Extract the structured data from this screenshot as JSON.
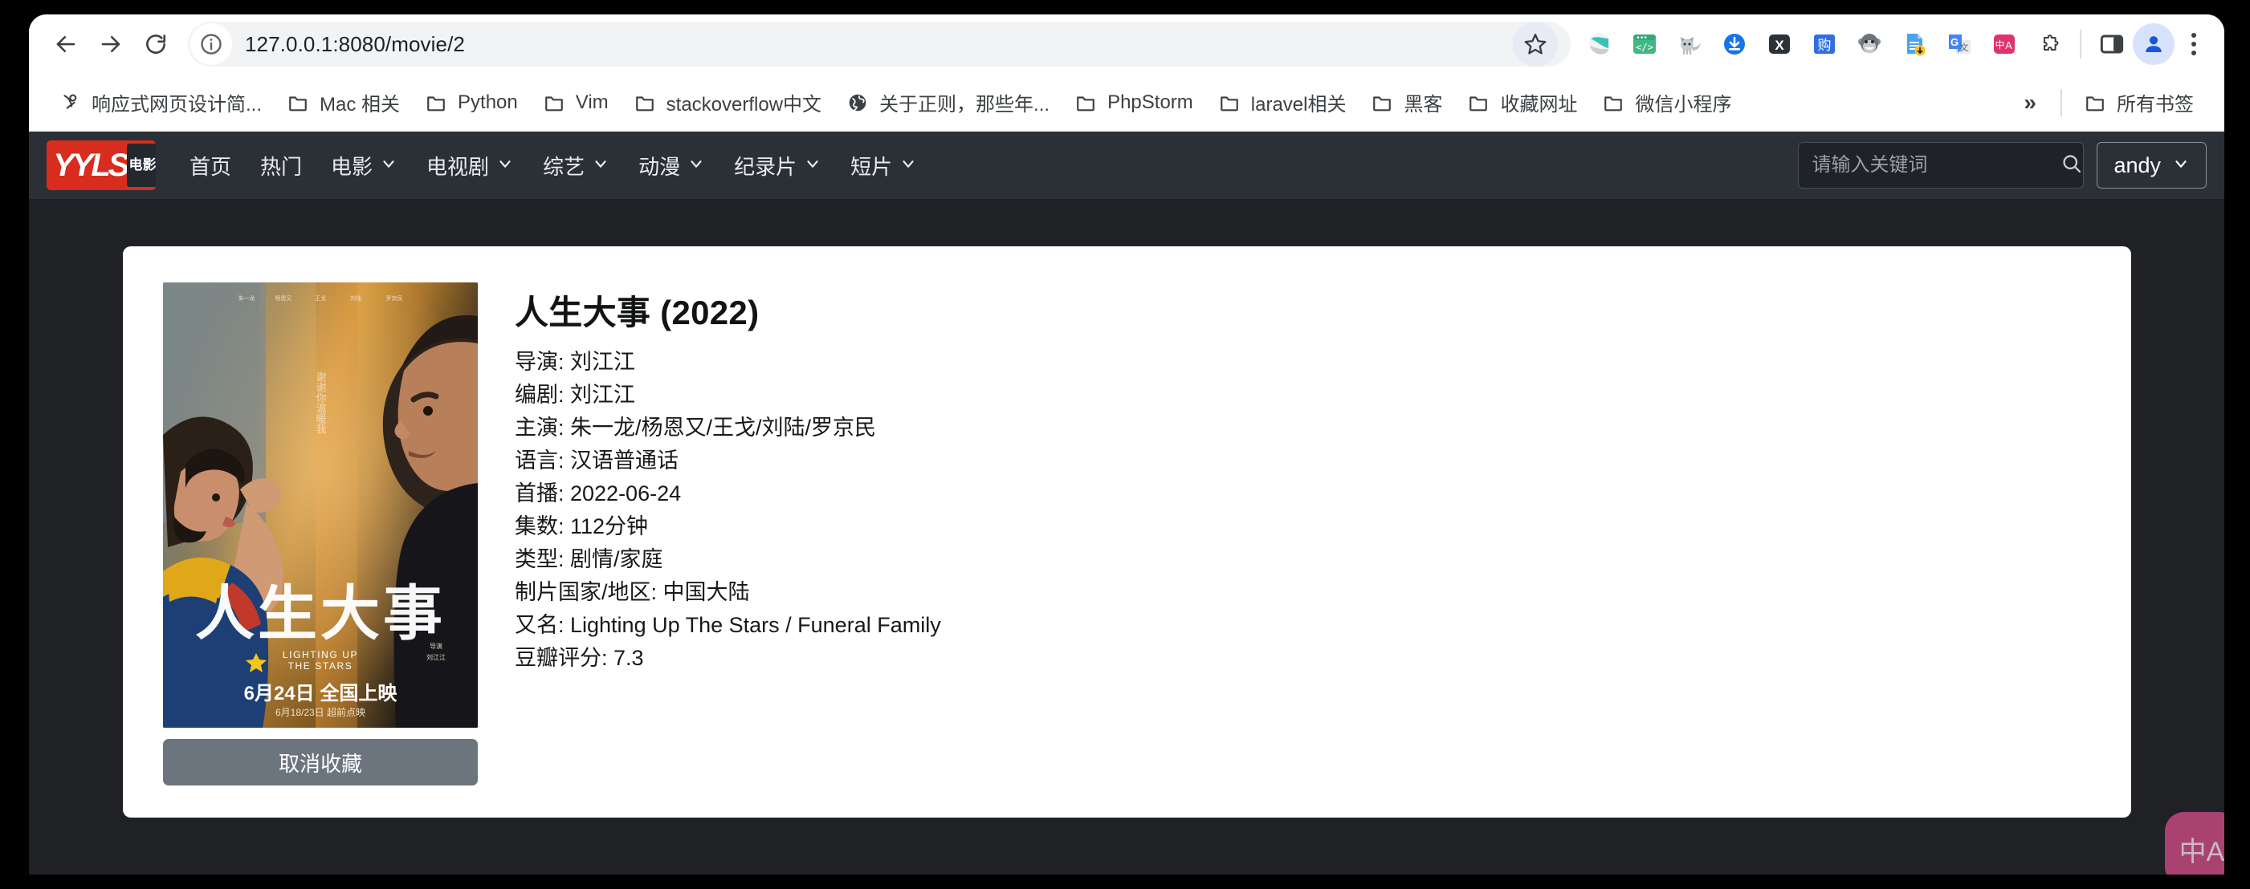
{
  "browser": {
    "back_tooltip": "Back",
    "forward_tooltip": "Forward",
    "reload_tooltip": "Reload",
    "url": "127.0.0.1:8080/movie/2",
    "bookmarks": [
      {
        "label": "响应式网页设计简...",
        "icon": "page-icon"
      },
      {
        "label": "Mac 相关",
        "icon": "folder-icon"
      },
      {
        "label": "Python",
        "icon": "folder-icon"
      },
      {
        "label": "Vim",
        "icon": "folder-icon"
      },
      {
        "label": "stackoverflow中文",
        "icon": "folder-icon"
      },
      {
        "label": "关于正则，那些年...",
        "icon": "globe-icon"
      },
      {
        "label": "PhpStorm",
        "icon": "folder-icon"
      },
      {
        "label": "laravel相关",
        "icon": "folder-icon"
      },
      {
        "label": "黑客",
        "icon": "folder-icon"
      },
      {
        "label": "收藏网址",
        "icon": "folder-icon"
      },
      {
        "label": "微信小程序",
        "icon": "folder-icon"
      }
    ],
    "bookmarks_overflow": "»",
    "all_bookmarks": "所有书签",
    "extensions": [
      "sphere-extension-icon",
      "code-window-extension-icon",
      "cat-extension-icon",
      "download-extension-icon",
      "x-extension-icon",
      "gou-extension-icon",
      "monkey-extension-icon",
      "doc-download-extension-icon",
      "google-translate-extension-icon",
      "translate-zh-extension-icon",
      "puzzle-extensions-icon"
    ]
  },
  "site": {
    "logo_text": "YYLS",
    "logo_badge": "电影",
    "nav": [
      {
        "label": "首页",
        "has_dropdown": false
      },
      {
        "label": "热门",
        "has_dropdown": false
      },
      {
        "label": "电影",
        "has_dropdown": true
      },
      {
        "label": "电视剧",
        "has_dropdown": true
      },
      {
        "label": "综艺",
        "has_dropdown": true
      },
      {
        "label": "动漫",
        "has_dropdown": true
      },
      {
        "label": "纪录片",
        "has_dropdown": true
      },
      {
        "label": "短片",
        "has_dropdown": true
      }
    ],
    "search_placeholder": "请输入关键词",
    "search_value": "",
    "user": "andy",
    "accent_color": "#d82d1e",
    "navbar_color": "#2b2f36",
    "page_background": "#1f2125"
  },
  "movie": {
    "title": "人生大事 (2022)",
    "poster_alt": "人生大事 电影海报",
    "favorite_button": "取消收藏",
    "favorite_button_color": "#6c757d",
    "details": [
      "导演: 刘江江",
      "编剧: 刘江江",
      "主演: 朱一龙/杨恩又/王戈/刘陆/罗京民",
      "语言: 汉语普通话",
      "首播: 2022-06-24",
      "集数: 112分钟",
      "类型: 剧情/家庭",
      "制片国家/地区: 中国大陆",
      "又名: Lighting Up The Stars / Funeral Family",
      "豆瓣评分: 7.3"
    ],
    "poster_text": {
      "title_cn": "人生大事",
      "title_en_line1": "LIGHTING UP",
      "title_en_line2": "THE STARS",
      "release": "6月24日 全国上映",
      "preview": "6月18/23日 超前点映",
      "tagline": "谢谢你温暖我"
    }
  },
  "floating": {
    "translate_badge": "中A"
  }
}
